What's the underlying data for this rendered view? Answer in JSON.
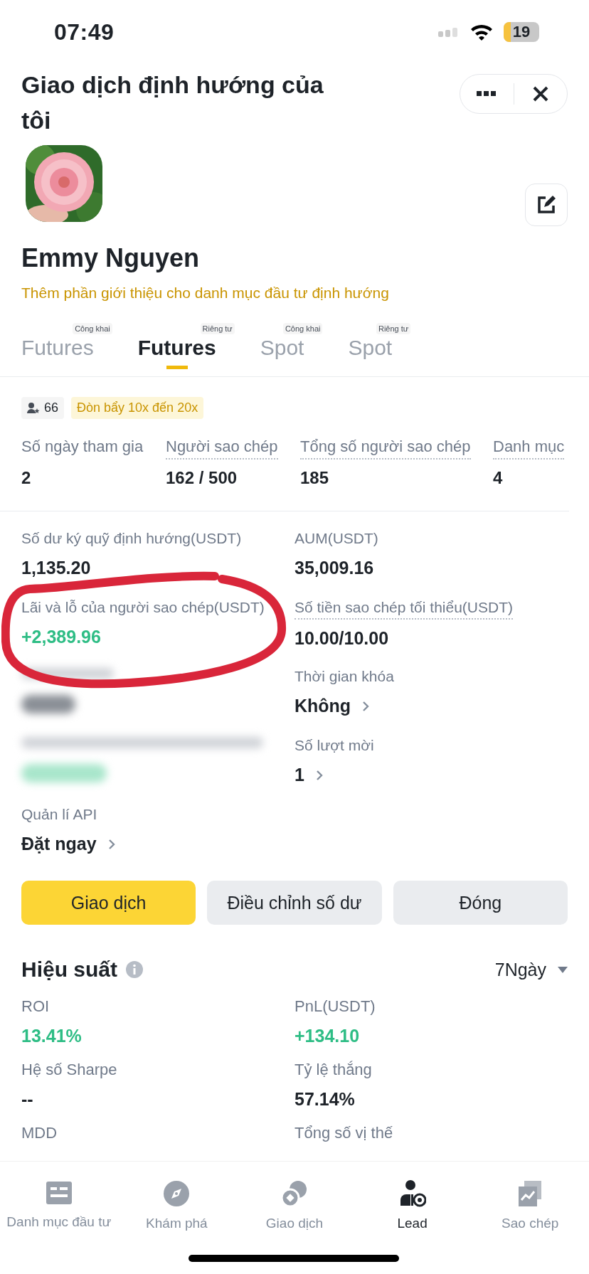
{
  "status_bar": {
    "time": "07:49",
    "battery": "19"
  },
  "header": {
    "title": "Giao dịch định hướng của tôi"
  },
  "profile": {
    "name": "Emmy Nguyen",
    "intro_link": "Thêm phần giới thiệu cho danh mục đầu tư định hướng"
  },
  "tabs": [
    {
      "badge": "Công khai",
      "label": "Futures",
      "selected": false
    },
    {
      "badge": "Riêng tư",
      "label": "Futures",
      "selected": true
    },
    {
      "badge": "Công khai",
      "label": "Spot",
      "selected": false
    },
    {
      "badge": "Riêng tư",
      "label": "Spot",
      "selected": false
    }
  ],
  "chips": [
    {
      "kind": "followers",
      "text": "66"
    },
    {
      "kind": "leverage",
      "text": "Đòn bẩy 10x đến 20x"
    }
  ],
  "stats": [
    {
      "label": "Số ngày tham gia",
      "value": "2",
      "dotted": false
    },
    {
      "label": "Người sao chép",
      "value": "162 / 500",
      "dotted": true
    },
    {
      "label": "Tổng số người sao chép",
      "value": "185",
      "dotted": true
    },
    {
      "label": "Danh mục",
      "value": "4",
      "dotted": true
    }
  ],
  "details": [
    {
      "kind": "stat",
      "label": "Số dư ký quỹ định hướng(USDT)",
      "value": "1,135.20",
      "positive": false,
      "chevron": false,
      "dotted": false,
      "annotated": false
    },
    {
      "kind": "stat",
      "label": "AUM(USDT)",
      "value": "35,009.16",
      "positive": false,
      "chevron": false,
      "dotted": false,
      "annotated": false
    },
    {
      "kind": "stat",
      "label": "Lãi và lỗ của người sao chép(USDT)",
      "value": "+2,389.96",
      "positive": true,
      "chevron": false,
      "dotted": false,
      "annotated": true
    },
    {
      "kind": "stat",
      "label": "Số tiền sao chép tối thiểu(USDT)",
      "value": "10.00/10.00",
      "positive": false,
      "chevron": false,
      "dotted": true,
      "annotated": false
    },
    {
      "kind": "blurred"
    },
    {
      "kind": "stat",
      "label": "Thời gian khóa",
      "value": "Không",
      "positive": false,
      "chevron": true,
      "dotted": false,
      "annotated": false
    },
    {
      "kind": "blurred"
    },
    {
      "kind": "stat",
      "label": "Số lượt mời",
      "value": "1",
      "positive": false,
      "chevron": true,
      "dotted": false,
      "annotated": false
    },
    {
      "kind": "stat",
      "label": "Quản lí API",
      "value": "Đặt ngay",
      "positive": false,
      "chevron": true,
      "dotted": false,
      "annotated": false
    }
  ],
  "actions": [
    {
      "label": "Giao dịch",
      "kind": "primary"
    },
    {
      "label": "Điều chỉnh số dư",
      "kind": "secondary"
    },
    {
      "label": "Đóng",
      "kind": "secondary"
    }
  ],
  "performance": {
    "title": "Hiệu suất",
    "period": "7Ngày",
    "metrics": [
      {
        "label": "ROI",
        "value": "13.41%",
        "positive": true
      },
      {
        "label": "PnL(USDT)",
        "value": "+134.10",
        "positive": true
      },
      {
        "label": "Hệ số Sharpe",
        "value": "--",
        "positive": false
      },
      {
        "label": "Tỷ lệ thắng",
        "value": "57.14%",
        "positive": false
      },
      {
        "label": "MDD"
      },
      {
        "label": "Tổng số vị thế"
      }
    ]
  },
  "bottom_nav": [
    {
      "label": "Danh mục đầu tư",
      "selected": false
    },
    {
      "label": "Khám phá",
      "selected": false
    },
    {
      "label": "Giao dịch",
      "selected": false
    },
    {
      "label": "Lead",
      "selected": true
    },
    {
      "label": "Sao chép",
      "selected": false
    }
  ]
}
